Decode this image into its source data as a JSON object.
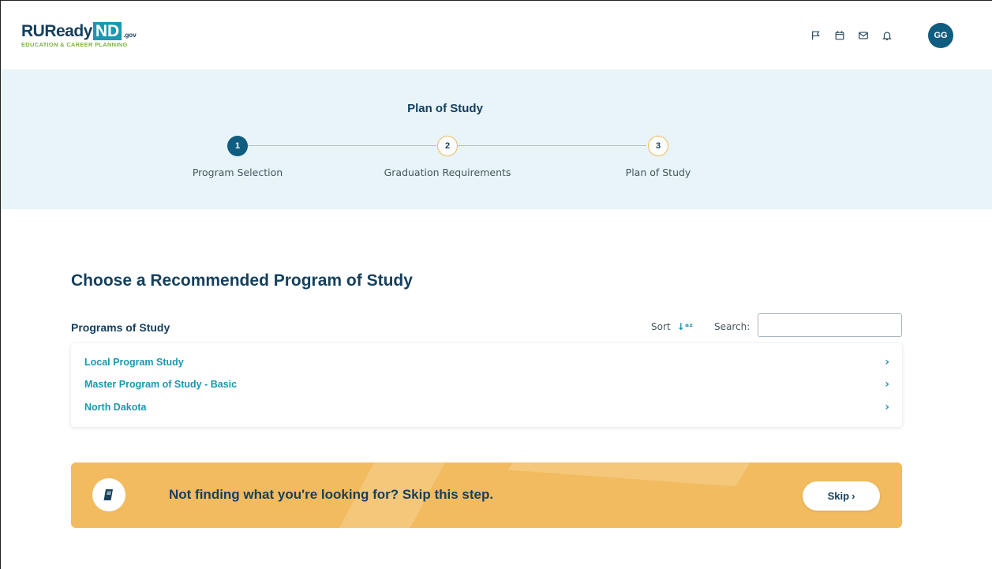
{
  "header": {
    "logo": {
      "brand": "RUReady",
      "state": "ND",
      "tld": ".gov",
      "tagline": "EDUCATION & CAREER PLANNING"
    },
    "icons": [
      "flag-icon",
      "calendar-icon",
      "mail-icon",
      "bell-icon"
    ],
    "avatar_initials": "GG"
  },
  "stepper": {
    "title": "Plan of Study",
    "steps": [
      {
        "number": "1",
        "label": "Program Selection",
        "state": "active"
      },
      {
        "number": "2",
        "label": "Graduation Requirements",
        "state": "inactive"
      },
      {
        "number": "3",
        "label": "Plan of Study",
        "state": "inactive"
      }
    ]
  },
  "main": {
    "title": "Choose a Recommended Program of Study",
    "list_title": "Programs of Study",
    "sort_label": "Sort",
    "sort_icon": "↓a-z",
    "search_label": "Search:",
    "search_value": "",
    "programs": [
      {
        "label": "Local Program Study",
        "chevron": "›"
      },
      {
        "label": "Master Program of Study - Basic",
        "chevron": "›"
      },
      {
        "label": "North Dakota",
        "chevron": "›"
      }
    ]
  },
  "banner": {
    "icon": "book-icon",
    "text": "Not finding what you're looking for? Skip this step.",
    "skip_label": "Skip",
    "skip_chevron": "›"
  },
  "colors": {
    "primary": "#0f5d80",
    "accent": "#1a98b0",
    "band_bg": "#e8f4f7",
    "banner_bg": "#f2bb5f",
    "step_ring": "#f0b95d",
    "logo_green": "#7cb342"
  }
}
